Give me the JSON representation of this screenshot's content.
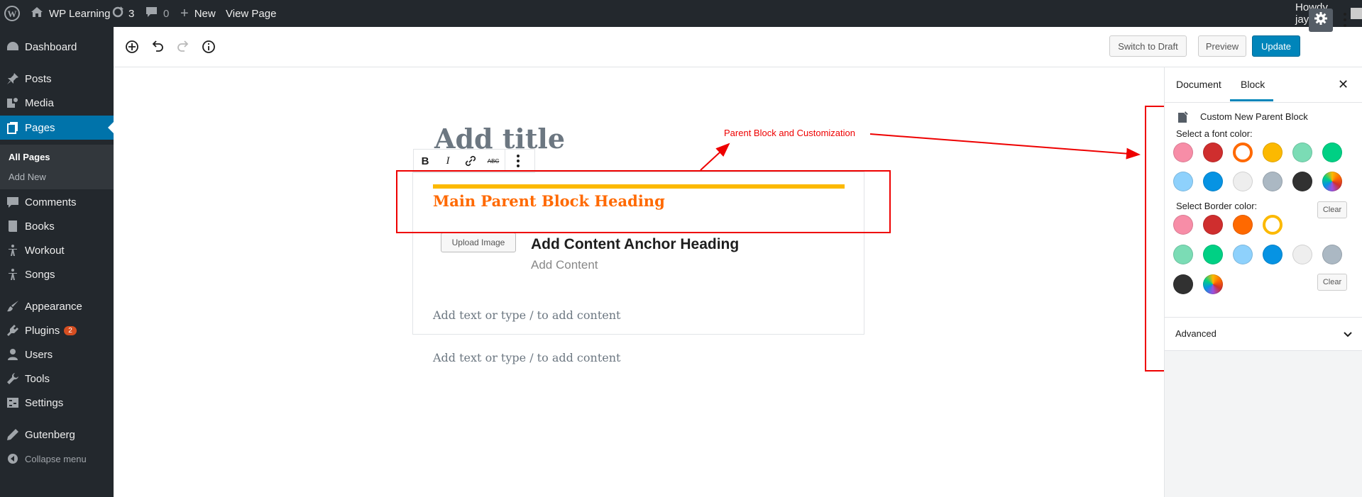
{
  "admin_bar": {
    "site_name": "WP Learning",
    "updates_count": "3",
    "comments_count": "0",
    "new_label": "New",
    "view_page_label": "View Page",
    "howdy": "Howdy, jay"
  },
  "sidebar": {
    "items": [
      {
        "label": "Dashboard",
        "icon": "dashboard-icon"
      },
      {
        "label": "Posts",
        "icon": "pin-icon"
      },
      {
        "label": "Media",
        "icon": "media-icon"
      },
      {
        "label": "Pages",
        "icon": "page-icon"
      },
      {
        "label": "Comments",
        "icon": "comment-icon"
      },
      {
        "label": "Books",
        "icon": "book-icon"
      },
      {
        "label": "Workout",
        "icon": "figure-icon"
      },
      {
        "label": "Songs",
        "icon": "figure-icon"
      },
      {
        "label": "Appearance",
        "icon": "brush-icon"
      },
      {
        "label": "Plugins",
        "icon": "plugin-icon",
        "badge": "2"
      },
      {
        "label": "Users",
        "icon": "user-icon"
      },
      {
        "label": "Tools",
        "icon": "wrench-icon"
      },
      {
        "label": "Settings",
        "icon": "settings-icon"
      },
      {
        "label": "Gutenberg",
        "icon": "pencil-icon"
      }
    ],
    "submenu": [
      "All Pages",
      "Add New"
    ],
    "collapse_label": "Collapse menu"
  },
  "toolbar": {
    "switch_draft": "Switch to Draft",
    "preview": "Preview",
    "update": "Update"
  },
  "editor": {
    "title_placeholder": "Add title",
    "block_toolbar": {
      "bold": "B",
      "italic": "I",
      "strike": "ABC"
    },
    "parent_heading": "Main Parent Block Heading",
    "upload_button": "Upload Image",
    "anchor_heading": "Add Content Anchor Heading",
    "add_content": "Add Content",
    "inner_placeholder": "Add text or type / to add content",
    "outer_placeholder": "Add text or type / to add content"
  },
  "annotation": {
    "label": "Parent Block and Customization",
    "color": "#e00000"
  },
  "panel": {
    "tab_document": "Document",
    "tab_block": "Block",
    "close": "✕",
    "block_name": "Custom New Parent Block",
    "font_color_label": "Select a font color:",
    "border_color_label": "Select Border color:",
    "clear_label": "Clear",
    "advanced_label": "Advanced",
    "font_colors": [
      "#f78da7",
      "#cf2e2e",
      "#ff6900",
      "#fcb900",
      "#7bdcb5",
      "#00d084",
      "#8ed1fc",
      "#0693e3",
      "#eeeeee",
      "#abb8c3",
      "#313131",
      "gradient"
    ],
    "font_color_selected": 2,
    "border_colors": [
      "#f78da7",
      "#cf2e2e",
      "#ff6900",
      "#fcb900",
      "#7bdcb5",
      "#00d084",
      "#8ed1fc",
      "#0693e3",
      "#eeeeee",
      "#abb8c3",
      "#313131",
      "gradient"
    ],
    "border_color_selected": 3
  },
  "colors": {
    "admin_dark": "#23282d",
    "accent_blue": "#0073aa",
    "heading_orange": "#ff6900",
    "bar_yellow": "#fcb900"
  }
}
